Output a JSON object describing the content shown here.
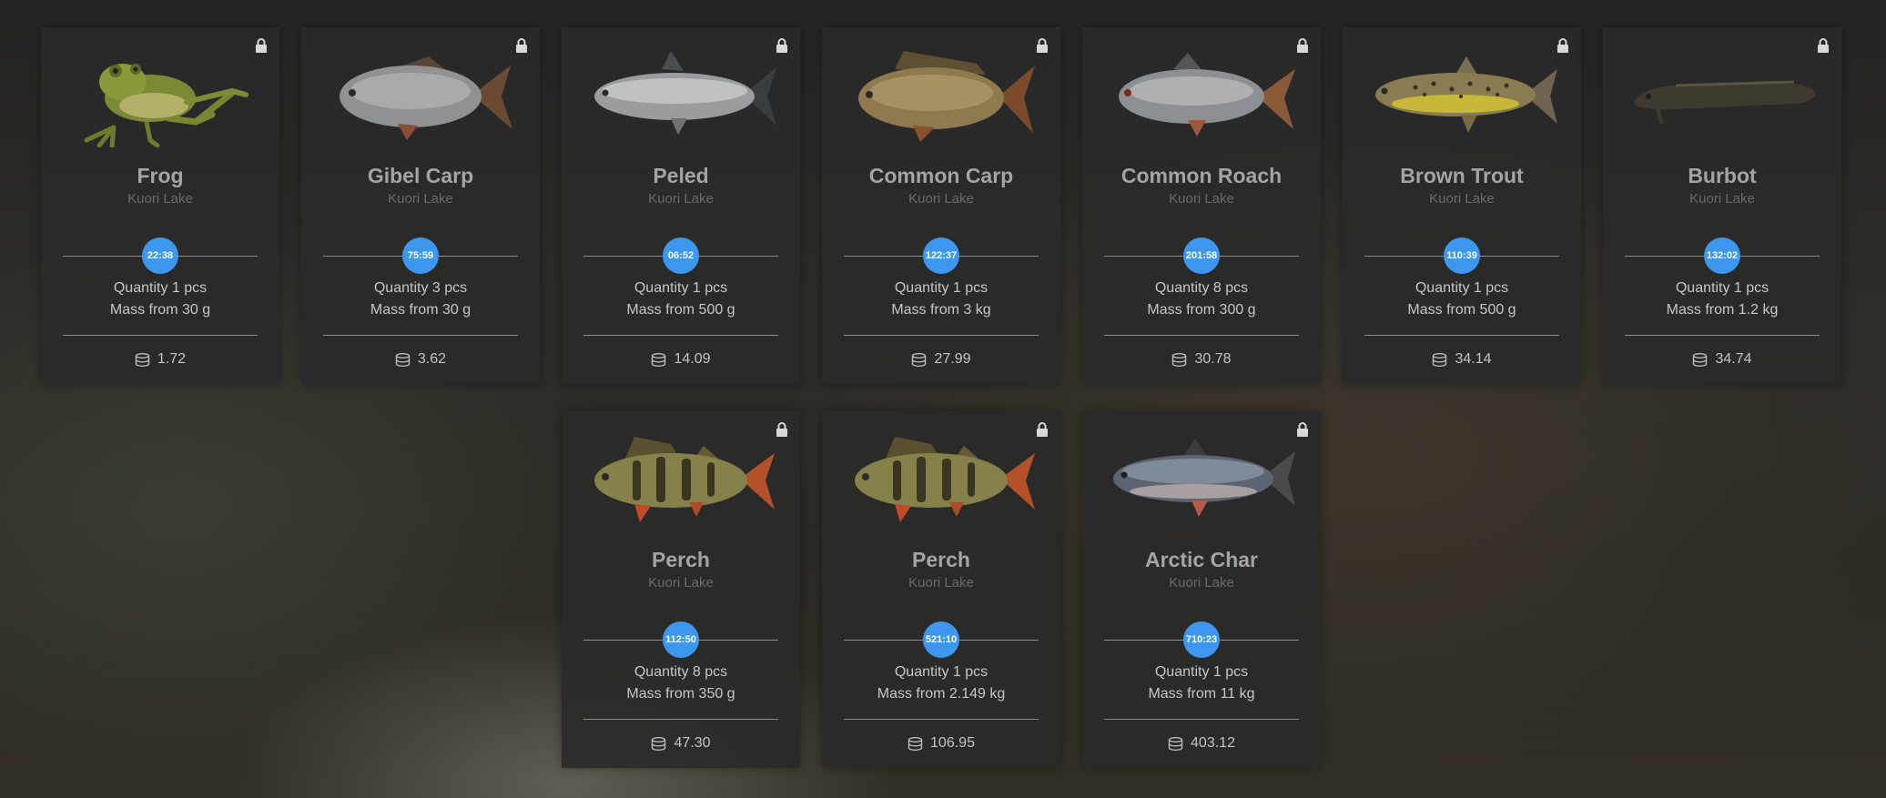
{
  "lock_icon": "padlock-icon",
  "coin_icon": "coin-stack-icon",
  "accent_color": "#3d97ef",
  "cards": [
    {
      "name": "Frog",
      "location": "Kuori Lake",
      "timer": "22:38",
      "quantity": "Quantity 1 pcs",
      "mass": "Mass from 30 g",
      "price": "1.72",
      "image": "frog-image"
    },
    {
      "name": "Gibel Carp",
      "location": "Kuori Lake",
      "timer": "75:59",
      "quantity": "Quantity 3 pcs",
      "mass": "Mass from 30 g",
      "price": "3.62",
      "image": "gibel-carp-image"
    },
    {
      "name": "Peled",
      "location": "Kuori Lake",
      "timer": "06:52",
      "quantity": "Quantity 1 pcs",
      "mass": "Mass from 500 g",
      "price": "14.09",
      "image": "peled-image"
    },
    {
      "name": "Common Carp",
      "location": "Kuori Lake",
      "timer": "122:37",
      "quantity": "Quantity 1 pcs",
      "mass": "Mass from 3 kg",
      "price": "27.99",
      "image": "common-carp-image"
    },
    {
      "name": "Common Roach",
      "location": "Kuori Lake",
      "timer": "201:58",
      "quantity": "Quantity 8 pcs",
      "mass": "Mass from 300 g",
      "price": "30.78",
      "image": "common-roach-image"
    },
    {
      "name": "Brown Trout",
      "location": "Kuori Lake",
      "timer": "110:39",
      "quantity": "Quantity 1 pcs",
      "mass": "Mass from 500 g",
      "price": "34.14",
      "image": "brown-trout-image"
    },
    {
      "name": "Burbot",
      "location": "Kuori Lake",
      "timer": "132:02",
      "quantity": "Quantity 1 pcs",
      "mass": "Mass from 1.2 kg",
      "price": "34.74",
      "image": "burbot-image"
    },
    {
      "name": "Perch",
      "location": "Kuori Lake",
      "timer": "112:50",
      "quantity": "Quantity 8 pcs",
      "mass": "Mass from 350 g",
      "price": "47.30",
      "image": "perch-image"
    },
    {
      "name": "Perch",
      "location": "Kuori Lake",
      "timer": "521:10",
      "quantity": "Quantity 1 pcs",
      "mass": "Mass from 2.149 kg",
      "price": "106.95",
      "image": "perch-image"
    },
    {
      "name": "Arctic Char",
      "location": "Kuori Lake",
      "timer": "710:23",
      "quantity": "Quantity 1 pcs",
      "mass": "Mass from 11 kg",
      "price": "403.12",
      "image": "arctic-char-image"
    }
  ]
}
